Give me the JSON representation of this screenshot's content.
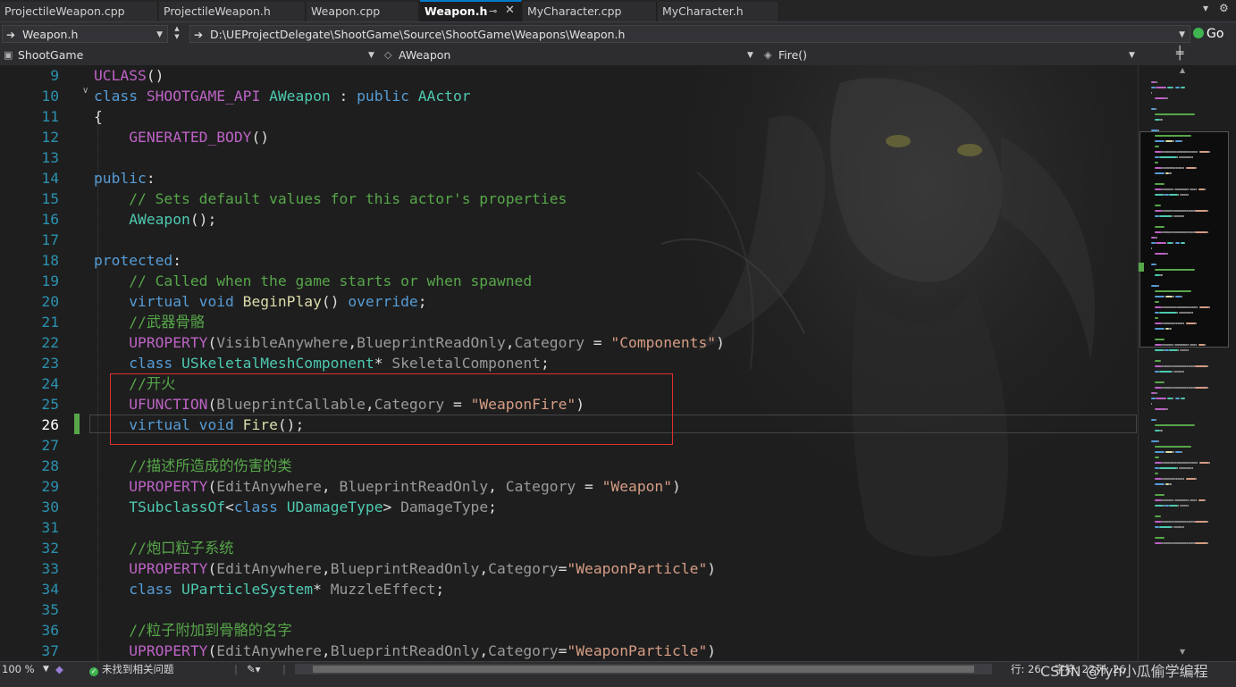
{
  "tabs": [
    {
      "label": "ProjectileWeapon.cpp",
      "active": false
    },
    {
      "label": "ProjectileWeapon.h",
      "active": false
    },
    {
      "label": "Weapon.cpp",
      "active": false
    },
    {
      "label": "Weapon.h",
      "active": true
    },
    {
      "label": "MyCharacter.cpp",
      "active": false
    },
    {
      "label": "MyCharacter.h",
      "active": false
    }
  ],
  "tab_icons": {
    "pin": "⊸",
    "close": "✕",
    "dropdown": "▾",
    "settings": "⚙"
  },
  "nav": {
    "file_combo": "Weapon.h",
    "path_combo": "D:\\UEProjectDelegate\\ShootGame\\Source\\ShootGame\\Weapons\\Weapon.h",
    "go_label": "Go"
  },
  "scope": {
    "project": "ShootGame",
    "class": "AWeapon",
    "member": "Fire()"
  },
  "editor": {
    "current_line": "26",
    "lines": [
      {
        "n": "9",
        "segs": [
          [
            "mac",
            "UCLASS"
          ],
          [
            "pl",
            "()"
          ]
        ]
      },
      {
        "n": "10",
        "segs": [
          [
            "kw",
            "class "
          ],
          [
            "mac",
            "SHOOTGAME_API "
          ],
          [
            "ty",
            "AWeapon"
          ],
          [
            "pl",
            " : "
          ],
          [
            "kw",
            "public "
          ],
          [
            "ty",
            "AActor"
          ]
        ]
      },
      {
        "n": "11",
        "segs": [
          [
            "pl",
            "{"
          ]
        ]
      },
      {
        "n": "12",
        "segs": [
          [
            "pl",
            "    "
          ],
          [
            "mac",
            "GENERATED_BODY"
          ],
          [
            "pl",
            "()"
          ]
        ]
      },
      {
        "n": "13",
        "segs": []
      },
      {
        "n": "14",
        "segs": [
          [
            "kw",
            "public"
          ],
          [
            "pl",
            ":"
          ]
        ]
      },
      {
        "n": "15",
        "segs": [
          [
            "pl",
            "    "
          ],
          [
            "cm",
            "// Sets default values for this actor's properties"
          ]
        ]
      },
      {
        "n": "16",
        "segs": [
          [
            "pl",
            "    "
          ],
          [
            "ty",
            "AWeapon"
          ],
          [
            "pl",
            "();"
          ]
        ]
      },
      {
        "n": "17",
        "segs": []
      },
      {
        "n": "18",
        "segs": [
          [
            "kw",
            "protected"
          ],
          [
            "pl",
            ":"
          ]
        ]
      },
      {
        "n": "19",
        "segs": [
          [
            "pl",
            "    "
          ],
          [
            "cm",
            "// Called when the game starts or when spawned"
          ]
        ]
      },
      {
        "n": "20",
        "segs": [
          [
            "pl",
            "    "
          ],
          [
            "kw",
            "virtual void "
          ],
          [
            "fn",
            "BeginPlay"
          ],
          [
            "pl",
            "() "
          ],
          [
            "kw",
            "override"
          ],
          [
            "pl",
            ";"
          ]
        ]
      },
      {
        "n": "21",
        "segs": [
          [
            "pl",
            "    "
          ],
          [
            "cm",
            "//武器骨骼"
          ]
        ]
      },
      {
        "n": "22",
        "segs": [
          [
            "pl",
            "    "
          ],
          [
            "mac",
            "UPROPERTY"
          ],
          [
            "pl",
            "("
          ],
          [
            "para",
            "VisibleAnywhere"
          ],
          [
            "pl",
            ","
          ],
          [
            "para",
            "BlueprintReadOnly"
          ],
          [
            "pl",
            ","
          ],
          [
            "para",
            "Category"
          ],
          [
            "pl",
            " = "
          ],
          [
            "str",
            "\"Components\""
          ],
          [
            "pl",
            ")"
          ]
        ]
      },
      {
        "n": "23",
        "segs": [
          [
            "pl",
            "    "
          ],
          [
            "kw",
            "class "
          ],
          [
            "ty",
            "USkeletalMeshComponent"
          ],
          [
            "pl",
            "* "
          ],
          [
            "para",
            "SkeletalComponent"
          ],
          [
            "pl",
            ";"
          ]
        ]
      },
      {
        "n": "24",
        "segs": [
          [
            "pl",
            "    "
          ],
          [
            "cm",
            "//开火"
          ]
        ]
      },
      {
        "n": "25",
        "segs": [
          [
            "pl",
            "    "
          ],
          [
            "mac",
            "UFUNCTION"
          ],
          [
            "pl",
            "("
          ],
          [
            "para",
            "BlueprintCallable"
          ],
          [
            "pl",
            ","
          ],
          [
            "para",
            "Category"
          ],
          [
            "pl",
            " = "
          ],
          [
            "str",
            "\"WeaponFire\""
          ],
          [
            "pl",
            ")"
          ]
        ]
      },
      {
        "n": "26",
        "segs": [
          [
            "pl",
            "    "
          ],
          [
            "kw",
            "virtual void "
          ],
          [
            "fn",
            "Fire"
          ],
          [
            "pl",
            "();"
          ]
        ]
      },
      {
        "n": "27",
        "segs": []
      },
      {
        "n": "28",
        "segs": [
          [
            "pl",
            "    "
          ],
          [
            "cm",
            "//描述所造成的伤害的类"
          ]
        ]
      },
      {
        "n": "29",
        "segs": [
          [
            "pl",
            "    "
          ],
          [
            "mac",
            "UPROPERTY"
          ],
          [
            "pl",
            "("
          ],
          [
            "para",
            "EditAnywhere"
          ],
          [
            "pl",
            ", "
          ],
          [
            "para",
            "BlueprintReadOnly"
          ],
          [
            "pl",
            ", "
          ],
          [
            "para",
            "Category"
          ],
          [
            "pl",
            " = "
          ],
          [
            "str",
            "\"Weapon\""
          ],
          [
            "pl",
            ")"
          ]
        ]
      },
      {
        "n": "30",
        "segs": [
          [
            "pl",
            "    "
          ],
          [
            "ty",
            "TSubclassOf"
          ],
          [
            "pl",
            "<"
          ],
          [
            "kw",
            "class "
          ],
          [
            "ty",
            "UDamageType"
          ],
          [
            "pl",
            "> "
          ],
          [
            "para",
            "DamageType"
          ],
          [
            "pl",
            ";"
          ]
        ]
      },
      {
        "n": "31",
        "segs": []
      },
      {
        "n": "32",
        "segs": [
          [
            "pl",
            "    "
          ],
          [
            "cm",
            "//炮口粒子系统"
          ]
        ]
      },
      {
        "n": "33",
        "segs": [
          [
            "pl",
            "    "
          ],
          [
            "mac",
            "UPROPERTY"
          ],
          [
            "pl",
            "("
          ],
          [
            "para",
            "EditAnywhere"
          ],
          [
            "pl",
            ","
          ],
          [
            "para",
            "BlueprintReadOnly"
          ],
          [
            "pl",
            ","
          ],
          [
            "para",
            "Category"
          ],
          [
            "pl",
            "="
          ],
          [
            "str",
            "\"WeaponParticle\""
          ],
          [
            "pl",
            ")"
          ]
        ]
      },
      {
        "n": "34",
        "segs": [
          [
            "pl",
            "    "
          ],
          [
            "kw",
            "class "
          ],
          [
            "ty",
            "UParticleSystem"
          ],
          [
            "pl",
            "* "
          ],
          [
            "para",
            "MuzzleEffect"
          ],
          [
            "pl",
            ";"
          ]
        ]
      },
      {
        "n": "35",
        "segs": []
      },
      {
        "n": "36",
        "segs": [
          [
            "pl",
            "    "
          ],
          [
            "cm",
            "//粒子附加到骨骼的名字"
          ]
        ]
      },
      {
        "n": "37",
        "segs": [
          [
            "pl",
            "    "
          ],
          [
            "mac",
            "UPROPERTY"
          ],
          [
            "pl",
            "("
          ],
          [
            "para",
            "EditAnywhere"
          ],
          [
            "pl",
            ","
          ],
          [
            "para",
            "BlueprintReadOnly"
          ],
          [
            "pl",
            ","
          ],
          [
            "para",
            "Category"
          ],
          [
            "pl",
            "="
          ],
          [
            "str",
            "\"WeaponParticle\""
          ],
          [
            "pl",
            ")"
          ]
        ]
      }
    ]
  },
  "status": {
    "zoom": "100 %",
    "issues": "未找到相关问题",
    "position": "行: 26  字符: 22  列: 26  制表符  CRLF",
    "row": "行: 26",
    "char": "字符: 22",
    "col": "列: 26",
    "watermark": "CSDN @fyh小瓜偷学编程"
  },
  "colors": {
    "accent": "#007acc",
    "keyword": "#569cd6",
    "macro": "#bd63c5",
    "type": "#4ec9b0",
    "function": "#dcdcaa",
    "string": "#d69d85",
    "comment": "#57a64a",
    "highlight_box": "#e03030"
  }
}
